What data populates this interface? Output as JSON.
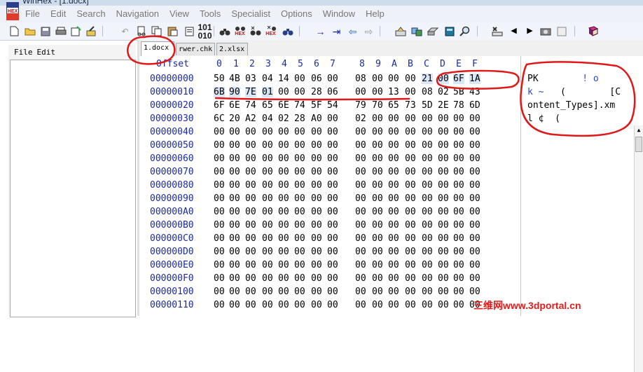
{
  "window": {
    "title": "WinHex - [1.docx]"
  },
  "menu": [
    "File",
    "Edit",
    "Search",
    "Navigation",
    "View",
    "Tools",
    "Specialist",
    "Options",
    "Window",
    "Help"
  ],
  "toolbar": {
    "hex_label": "HEX"
  },
  "left_panel": {
    "menu": [
      "File",
      "Edit"
    ]
  },
  "tabs": [
    "1.docx",
    "rwer.chk",
    "2.xlsx"
  ],
  "hex": {
    "offset_label": "Offset",
    "columns": [
      "0",
      "1",
      "2",
      "3",
      "4",
      "5",
      "6",
      "7",
      "8",
      "9",
      "A",
      "B",
      "C",
      "D",
      "E",
      "F"
    ],
    "rows": [
      {
        "offset": "00000000",
        "bytes": [
          "50",
          "4B",
          "03",
          "04",
          "14",
          "00",
          "06",
          "00",
          "08",
          "00",
          "00",
          "00",
          "21",
          "00",
          "6F",
          "1A"
        ]
      },
      {
        "offset": "00000010",
        "bytes": [
          "6B",
          "90",
          "7E",
          "01",
          "00",
          "00",
          "28",
          "06",
          "00",
          "00",
          "13",
          "00",
          "08",
          "02",
          "5B",
          "43"
        ]
      },
      {
        "offset": "00000020",
        "bytes": [
          "6F",
          "6E",
          "74",
          "65",
          "6E",
          "74",
          "5F",
          "54",
          "79",
          "70",
          "65",
          "73",
          "5D",
          "2E",
          "78",
          "6D"
        ]
      },
      {
        "offset": "00000030",
        "bytes": [
          "6C",
          "20",
          "A2",
          "04",
          "02",
          "28",
          "A0",
          "00",
          "02",
          "00",
          "00",
          "00",
          "00",
          "00",
          "00",
          "00"
        ]
      },
      {
        "offset": "00000040",
        "bytes": [
          "00",
          "00",
          "00",
          "00",
          "00",
          "00",
          "00",
          "00",
          "00",
          "00",
          "00",
          "00",
          "00",
          "00",
          "00",
          "00"
        ]
      },
      {
        "offset": "00000050",
        "bytes": [
          "00",
          "00",
          "00",
          "00",
          "00",
          "00",
          "00",
          "00",
          "00",
          "00",
          "00",
          "00",
          "00",
          "00",
          "00",
          "00"
        ]
      },
      {
        "offset": "00000060",
        "bytes": [
          "00",
          "00",
          "00",
          "00",
          "00",
          "00",
          "00",
          "00",
          "00",
          "00",
          "00",
          "00",
          "00",
          "00",
          "00",
          "00"
        ]
      },
      {
        "offset": "00000070",
        "bytes": [
          "00",
          "00",
          "00",
          "00",
          "00",
          "00",
          "00",
          "00",
          "00",
          "00",
          "00",
          "00",
          "00",
          "00",
          "00",
          "00"
        ]
      },
      {
        "offset": "00000080",
        "bytes": [
          "00",
          "00",
          "00",
          "00",
          "00",
          "00",
          "00",
          "00",
          "00",
          "00",
          "00",
          "00",
          "00",
          "00",
          "00",
          "00"
        ]
      },
      {
        "offset": "00000090",
        "bytes": [
          "00",
          "00",
          "00",
          "00",
          "00",
          "00",
          "00",
          "00",
          "00",
          "00",
          "00",
          "00",
          "00",
          "00",
          "00",
          "00"
        ]
      },
      {
        "offset": "000000A0",
        "bytes": [
          "00",
          "00",
          "00",
          "00",
          "00",
          "00",
          "00",
          "00",
          "00",
          "00",
          "00",
          "00",
          "00",
          "00",
          "00",
          "00"
        ]
      },
      {
        "offset": "000000B0",
        "bytes": [
          "00",
          "00",
          "00",
          "00",
          "00",
          "00",
          "00",
          "00",
          "00",
          "00",
          "00",
          "00",
          "00",
          "00",
          "00",
          "00"
        ]
      },
      {
        "offset": "000000C0",
        "bytes": [
          "00",
          "00",
          "00",
          "00",
          "00",
          "00",
          "00",
          "00",
          "00",
          "00",
          "00",
          "00",
          "00",
          "00",
          "00",
          "00"
        ]
      },
      {
        "offset": "000000D0",
        "bytes": [
          "00",
          "00",
          "00",
          "00",
          "00",
          "00",
          "00",
          "00",
          "00",
          "00",
          "00",
          "00",
          "00",
          "00",
          "00",
          "00"
        ]
      },
      {
        "offset": "000000E0",
        "bytes": [
          "00",
          "00",
          "00",
          "00",
          "00",
          "00",
          "00",
          "00",
          "00",
          "00",
          "00",
          "00",
          "00",
          "00",
          "00",
          "00"
        ]
      },
      {
        "offset": "000000F0",
        "bytes": [
          "00",
          "00",
          "00",
          "00",
          "00",
          "00",
          "00",
          "00",
          "00",
          "00",
          "00",
          "00",
          "00",
          "00",
          "00",
          "00"
        ]
      },
      {
        "offset": "00000100",
        "bytes": [
          "00",
          "00",
          "00",
          "00",
          "00",
          "00",
          "00",
          "00",
          "00",
          "00",
          "00",
          "00",
          "00",
          "00",
          "00",
          "00"
        ]
      },
      {
        "offset": "00000110",
        "bytes": [
          "00",
          "00",
          "00",
          "00",
          "00",
          "00",
          "00",
          "00",
          "00",
          "00",
          "00",
          "00",
          "00",
          "00",
          "00",
          "00"
        ]
      }
    ],
    "text_rows": [
      [
        {
          "t": "PK"
        },
        {
          "t": "        "
        },
        {
          "t": "! o",
          "hl": true
        }
      ],
      [
        {
          "t": "k ~",
          "hl": true
        },
        {
          "t": "   (        [C"
        }
      ],
      [
        {
          "t": "ontent_Types].xm"
        }
      ],
      [
        {
          "t": "l ¢  ("
        }
      ]
    ]
  },
  "watermark": "三维网www.3dportal.cn",
  "colors": {
    "offset_blue": "#1a2aa0",
    "selection": "#d9e6f6",
    "annotation_red": "#e01818"
  }
}
